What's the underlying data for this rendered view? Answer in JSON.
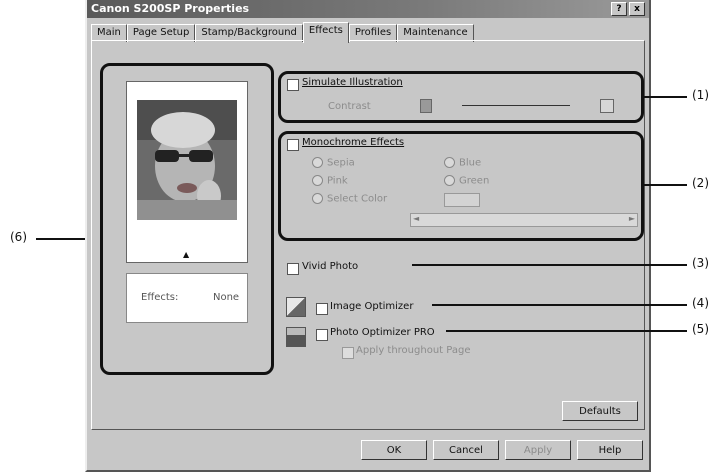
{
  "window": {
    "title": "Canon S200SP Properties",
    "help_button": "?",
    "close_button": "x"
  },
  "tabs": [
    "Main",
    "Page Setup",
    "Stamp/Background",
    "Effects",
    "Profiles",
    "Maintenance"
  ],
  "active_tab": "Effects",
  "preview": {
    "effects_label": "Effects:",
    "effects_value": "None"
  },
  "simulate": {
    "label": "Simulate Illustration",
    "contrast_label": "Contrast"
  },
  "monochrome": {
    "label": "Monochrome Effects",
    "options": [
      "Sepia",
      "Blue",
      "Pink",
      "Green",
      "Select Color"
    ]
  },
  "vivid": {
    "label": "Vivid Photo"
  },
  "optimizer": {
    "label": "Image Optimizer"
  },
  "photo_opt": {
    "label": "Photo Optimizer PRO",
    "sub_label": "Apply throughout Page"
  },
  "buttons": {
    "defaults": "Defaults",
    "ok": "OK",
    "cancel": "Cancel",
    "apply": "Apply",
    "help": "Help"
  },
  "callouts": [
    "(1)",
    "(2)",
    "(3)",
    "(4)",
    "(5)",
    "(6)"
  ],
  "colors": {
    "callout_border": "#111111",
    "dialog_bg": "#c7c7c7"
  }
}
